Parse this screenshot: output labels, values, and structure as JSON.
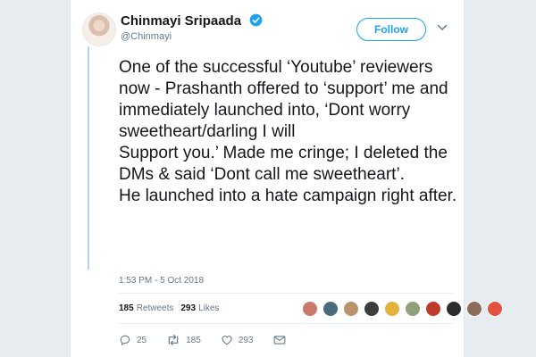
{
  "author": {
    "name": "Chinmayi Sripaada",
    "handle": "@Chinmayi",
    "avatar_icon": "user-avatar",
    "verified_icon": "verified-badge-icon"
  },
  "header": {
    "follow_label": "Follow",
    "menu_icon": "chevron-down-icon"
  },
  "tweet": {
    "lines": [
      "One of the successful ‘Youtube’ reviewers now - Prashanth offered to ‘support’ me and immediately launched into, ‘Dont worry sweetheart/darling I will",
      "Support you.’ Made me cringe; I deleted the DMs & said ‘Dont call me sweetheart’.",
      "He launched into a hate campaign right after."
    ],
    "timestamp": "1:53 PM - 5 Oct 2018"
  },
  "stats": {
    "retweets_count": "185",
    "retweets_label": "Retweets",
    "likes_count": "293",
    "likes_label": "Likes"
  },
  "liker_avatars": [
    {
      "color": "#c9786b"
    },
    {
      "color": "#4a6a7d"
    },
    {
      "color": "#b9936c"
    },
    {
      "color": "#3d3d3d"
    },
    {
      "color": "#e3b23c"
    },
    {
      "color": "#8fa07a"
    },
    {
      "color": "#c0392b"
    },
    {
      "color": "#2c2c2c"
    },
    {
      "color": "#8a6d5b"
    },
    {
      "color": "#e0533c"
    }
  ],
  "actions": {
    "reply_count": "25",
    "retweet_count": "185",
    "like_count": "293",
    "reply_icon": "reply-icon",
    "retweet_icon": "retweet-icon",
    "like_icon": "heart-icon",
    "dm_icon": "envelope-icon"
  },
  "colors": {
    "accent": "#1da1f2",
    "text": "#14171a",
    "muted": "#657786"
  }
}
